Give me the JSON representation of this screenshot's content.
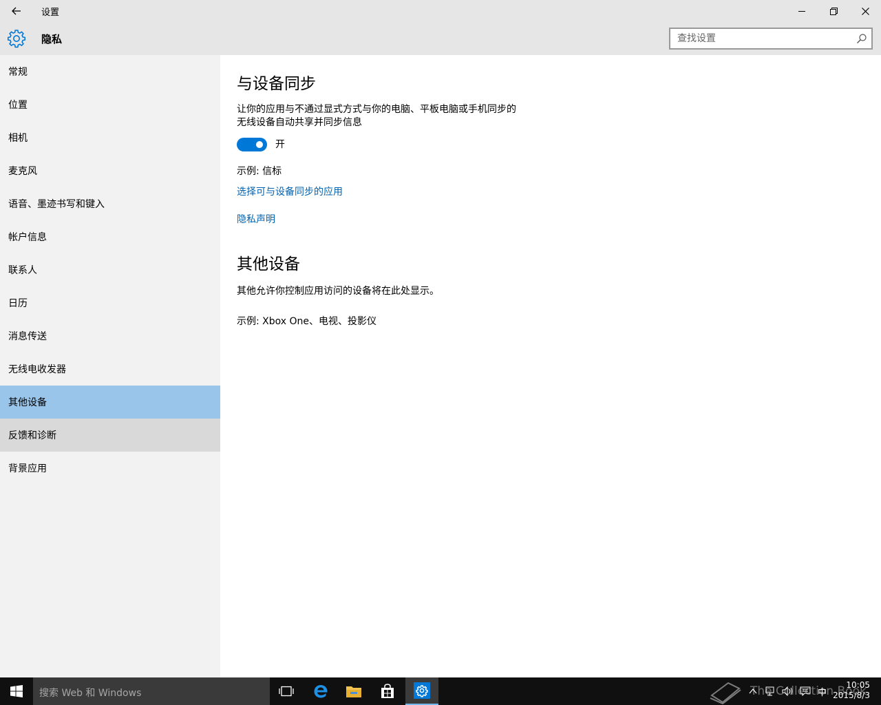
{
  "window": {
    "title": "设置"
  },
  "header": {
    "title": "隐私",
    "icon": "gear-icon",
    "search_placeholder": "查找设置"
  },
  "sidebar": {
    "items": [
      {
        "label": "常规"
      },
      {
        "label": "位置"
      },
      {
        "label": "相机"
      },
      {
        "label": "麦克风"
      },
      {
        "label": "语音、墨迹书写和键入"
      },
      {
        "label": "帐户信息"
      },
      {
        "label": "联系人"
      },
      {
        "label": "日历"
      },
      {
        "label": "消息传送"
      },
      {
        "label": "无线电收发器"
      },
      {
        "label": "其他设备",
        "state": "selected"
      },
      {
        "label": "反馈和诊断",
        "state": "hover"
      },
      {
        "label": "背景应用"
      }
    ]
  },
  "main": {
    "sync_heading": "与设备同步",
    "sync_desc_line1": "让你的应用与不通过显式方式与你的电脑、平板电脑或手机同步的",
    "sync_desc_line2": "无线设备自动共享并同步信息",
    "toggle_state": "on",
    "toggle_label": "开",
    "example_beacon": "示例: 信标",
    "choose_apps_link": "选择可与设备同步的应用",
    "privacy_link": "隐私声明",
    "other_heading": "其他设备",
    "other_desc": "其他允许你控制应用访问的设备将在此处显示。",
    "other_example": "示例: Xbox One、电视、投影仪"
  },
  "taskbar": {
    "search_placeholder": "搜索 Web 和 Windows",
    "watermark": "The Collection Book",
    "ime": "中",
    "time": "10:05",
    "date": "2015/8/3"
  },
  "colors": {
    "accent": "#0078d7",
    "link": "#0063b1",
    "selected_nav": "#99c5ea",
    "hover_nav": "#d9d9d9"
  }
}
